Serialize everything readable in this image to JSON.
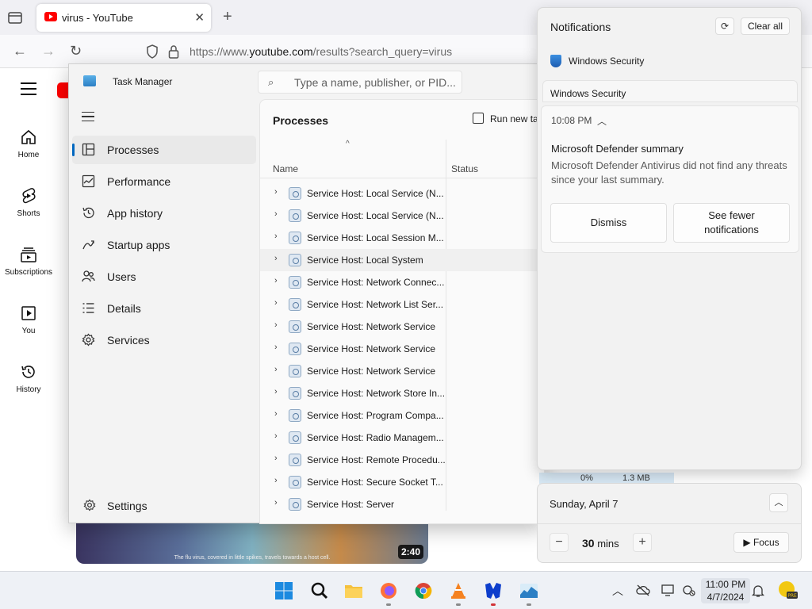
{
  "browser": {
    "tab_title": "virus - YouTube",
    "url_host_prefix": "https://www.",
    "url_host": "youtube.com",
    "url_path": "/results?search_query=virus"
  },
  "youtube": {
    "side_items": [
      {
        "label": "Home",
        "icon": "home-icon"
      },
      {
        "label": "Shorts",
        "icon": "shorts-icon"
      },
      {
        "label": "Subscriptions",
        "icon": "subscriptions-icon"
      },
      {
        "label": "You",
        "icon": "you-icon"
      },
      {
        "label": "History",
        "icon": "history-icon"
      }
    ],
    "video_caption": "The flu virus, covered in little spikes, travels towards a host cell.",
    "video_duration": "2:40"
  },
  "task_manager": {
    "title": "Task Manager",
    "search_placeholder": "Type a name, publisher, or PID...",
    "nav": [
      {
        "label": "Processes",
        "icon": "processes-icon",
        "active": true
      },
      {
        "label": "Performance",
        "icon": "performance-icon"
      },
      {
        "label": "App history",
        "icon": "app-history-icon"
      },
      {
        "label": "Startup apps",
        "icon": "startup-apps-icon"
      },
      {
        "label": "Users",
        "icon": "users-icon"
      },
      {
        "label": "Details",
        "icon": "details-icon"
      },
      {
        "label": "Services",
        "icon": "services-icon"
      }
    ],
    "settings_label": "Settings",
    "heading": "Processes",
    "run_new_task": "Run new ta",
    "columns": {
      "name": "Name",
      "status": "Status"
    },
    "processes": [
      "Service Host: Local Service (N...",
      "Service Host: Local Service (N...",
      "Service Host: Local Session M...",
      "Service Host: Local System",
      "Service Host: Network Connec...",
      "Service Host: Network List Ser...",
      "Service Host: Network Service",
      "Service Host: Network Service",
      "Service Host: Network Service",
      "Service Host: Network Store In...",
      "Service Host: Program Compa...",
      "Service Host: Radio Managem...",
      "Service Host: Remote Procedu...",
      "Service Host: Secure Socket T...",
      "Service Host: Server"
    ],
    "highlighted_row": 3,
    "bg_cpu": "0%",
    "bg_mem": "1.3 MB"
  },
  "notifications": {
    "title": "Notifications",
    "clear_all": "Clear all",
    "app_name": "Windows Security",
    "stacked_label": "Windows Security",
    "time": "10:08 PM",
    "heading": "Microsoft Defender summary",
    "body": "Microsoft Defender Antivirus did not find any threats since your last summary.",
    "dismiss": "Dismiss",
    "see_fewer": "See fewer notifications"
  },
  "calendar": {
    "date": "Sunday, April 7",
    "minutes_value": "30",
    "minutes_unit": "mins",
    "focus_label": "Focus"
  },
  "taskbar": {
    "time": "11:00 PM",
    "date": "4/7/2024",
    "apps": [
      "windows-start-icon",
      "search-icon",
      "file-explorer-icon",
      "firefox-icon",
      "chrome-icon",
      "vlc-icon",
      "malwarebytes-icon",
      "task-manager-icon"
    ],
    "colors": {
      "accent": "#0067c0",
      "youtube_red": "#ff0000"
    }
  }
}
